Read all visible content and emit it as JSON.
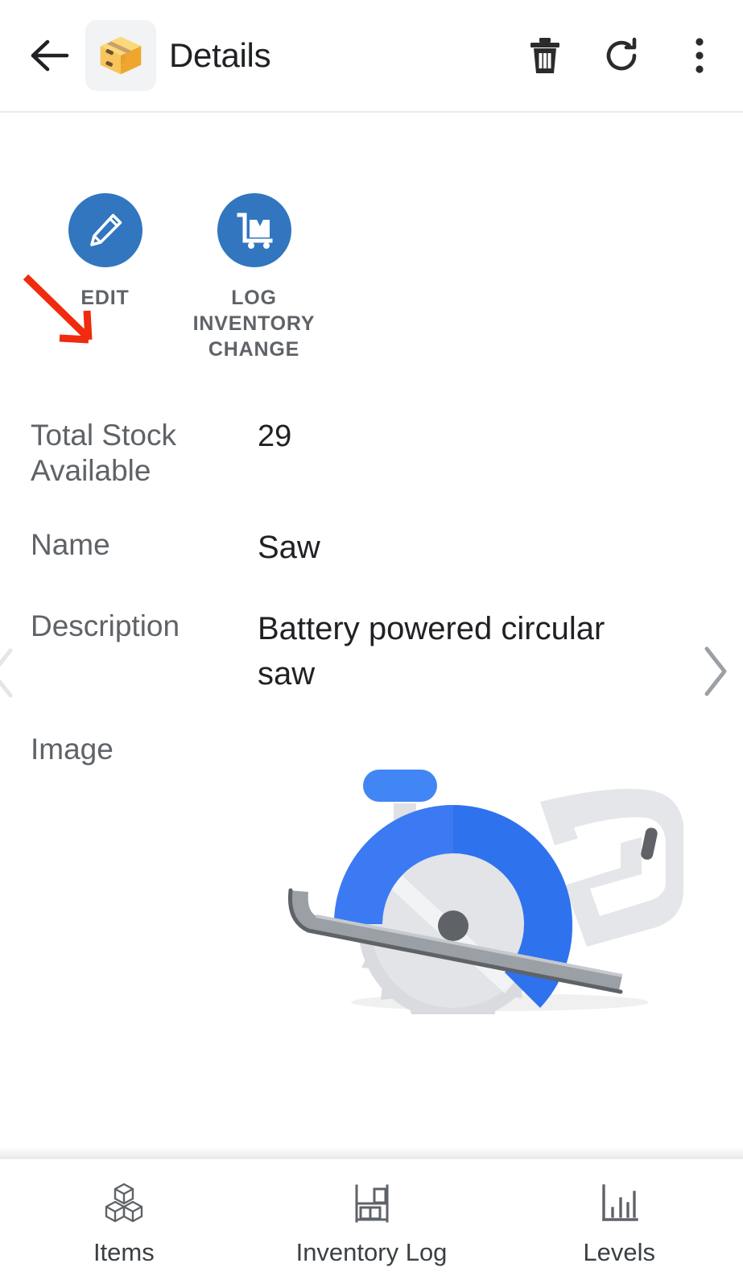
{
  "header": {
    "title": "Details",
    "back_icon": "arrow-left-icon",
    "app_icon": "package-emoji-icon",
    "actions": [
      {
        "name": "delete",
        "icon": "trash-icon"
      },
      {
        "name": "refresh",
        "icon": "refresh-icon"
      },
      {
        "name": "overflow",
        "icon": "more-vertical-icon"
      }
    ]
  },
  "actions": [
    {
      "label": "EDIT",
      "icon": "pencil-icon"
    },
    {
      "label": "LOG INVENTORY CHANGE",
      "icon": "hand-truck-package-icon"
    }
  ],
  "annotation": {
    "type": "arrow",
    "color": "#f02b0e",
    "points_to": "EDIT"
  },
  "fields": [
    {
      "label": "Total Stock Available",
      "value": "29"
    },
    {
      "label": "Name",
      "value": "Saw"
    },
    {
      "label": "Description",
      "value": "Battery powered circular saw"
    },
    {
      "label": "Image",
      "value": ""
    }
  ],
  "record_nav": {
    "prev_icon": "chevron-left-icon",
    "next_icon": "chevron-right-icon"
  },
  "image": {
    "alt": "circular saw illustration",
    "blade_guard_color": "#3b7af2",
    "body_color": "#e3e5e8",
    "blade_color": "#d8dade"
  },
  "bottom_nav": [
    {
      "label": "Items",
      "icon": "cubes-icon"
    },
    {
      "label": "Inventory Log",
      "icon": "shelf-boxes-icon"
    },
    {
      "label": "Levels",
      "icon": "bar-chart-icon"
    }
  ],
  "colors": {
    "accent_blue": "#3176bf",
    "label_gray": "#5f6368",
    "value_dark": "#202124",
    "divider": "#e8eaed"
  }
}
